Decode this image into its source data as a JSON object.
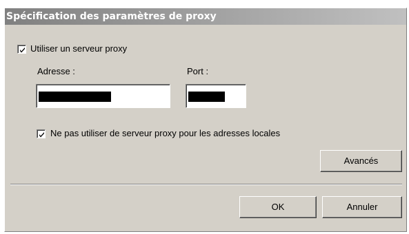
{
  "window": {
    "title": "Spécification des paramètres de proxy"
  },
  "proxy": {
    "use_proxy_label": "Utiliser un serveur proxy",
    "use_proxy_checked": true,
    "address_label": "Adresse :",
    "address_value": "",
    "port_label": "Port :",
    "port_value": "",
    "bypass_local_label": "Ne pas utiliser de serveur proxy pour les adresses locales",
    "bypass_local_checked": true
  },
  "buttons": {
    "advanced_label": "Avancés",
    "ok_label": "OK",
    "cancel_label": "Annuler"
  },
  "icons": {
    "checkmark": "checkmark-icon"
  }
}
